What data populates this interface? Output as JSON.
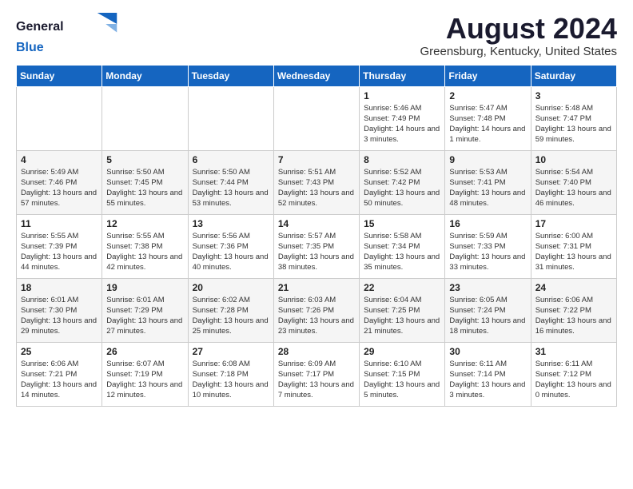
{
  "header": {
    "logo_line1": "General",
    "logo_line2": "Blue",
    "month_year": "August 2024",
    "location": "Greensburg, Kentucky, United States"
  },
  "weekdays": [
    "Sunday",
    "Monday",
    "Tuesday",
    "Wednesday",
    "Thursday",
    "Friday",
    "Saturday"
  ],
  "weeks": [
    [
      {
        "day": "",
        "content": ""
      },
      {
        "day": "",
        "content": ""
      },
      {
        "day": "",
        "content": ""
      },
      {
        "day": "",
        "content": ""
      },
      {
        "day": "1",
        "content": "Sunrise: 5:46 AM\nSunset: 7:49 PM\nDaylight: 14 hours\nand 3 minutes."
      },
      {
        "day": "2",
        "content": "Sunrise: 5:47 AM\nSunset: 7:48 PM\nDaylight: 14 hours\nand 1 minute."
      },
      {
        "day": "3",
        "content": "Sunrise: 5:48 AM\nSunset: 7:47 PM\nDaylight: 13 hours\nand 59 minutes."
      }
    ],
    [
      {
        "day": "4",
        "content": "Sunrise: 5:49 AM\nSunset: 7:46 PM\nDaylight: 13 hours\nand 57 minutes."
      },
      {
        "day": "5",
        "content": "Sunrise: 5:50 AM\nSunset: 7:45 PM\nDaylight: 13 hours\nand 55 minutes."
      },
      {
        "day": "6",
        "content": "Sunrise: 5:50 AM\nSunset: 7:44 PM\nDaylight: 13 hours\nand 53 minutes."
      },
      {
        "day": "7",
        "content": "Sunrise: 5:51 AM\nSunset: 7:43 PM\nDaylight: 13 hours\nand 52 minutes."
      },
      {
        "day": "8",
        "content": "Sunrise: 5:52 AM\nSunset: 7:42 PM\nDaylight: 13 hours\nand 50 minutes."
      },
      {
        "day": "9",
        "content": "Sunrise: 5:53 AM\nSunset: 7:41 PM\nDaylight: 13 hours\nand 48 minutes."
      },
      {
        "day": "10",
        "content": "Sunrise: 5:54 AM\nSunset: 7:40 PM\nDaylight: 13 hours\nand 46 minutes."
      }
    ],
    [
      {
        "day": "11",
        "content": "Sunrise: 5:55 AM\nSunset: 7:39 PM\nDaylight: 13 hours\nand 44 minutes."
      },
      {
        "day": "12",
        "content": "Sunrise: 5:55 AM\nSunset: 7:38 PM\nDaylight: 13 hours\nand 42 minutes."
      },
      {
        "day": "13",
        "content": "Sunrise: 5:56 AM\nSunset: 7:36 PM\nDaylight: 13 hours\nand 40 minutes."
      },
      {
        "day": "14",
        "content": "Sunrise: 5:57 AM\nSunset: 7:35 PM\nDaylight: 13 hours\nand 38 minutes."
      },
      {
        "day": "15",
        "content": "Sunrise: 5:58 AM\nSunset: 7:34 PM\nDaylight: 13 hours\nand 35 minutes."
      },
      {
        "day": "16",
        "content": "Sunrise: 5:59 AM\nSunset: 7:33 PM\nDaylight: 13 hours\nand 33 minutes."
      },
      {
        "day": "17",
        "content": "Sunrise: 6:00 AM\nSunset: 7:31 PM\nDaylight: 13 hours\nand 31 minutes."
      }
    ],
    [
      {
        "day": "18",
        "content": "Sunrise: 6:01 AM\nSunset: 7:30 PM\nDaylight: 13 hours\nand 29 minutes."
      },
      {
        "day": "19",
        "content": "Sunrise: 6:01 AM\nSunset: 7:29 PM\nDaylight: 13 hours\nand 27 minutes."
      },
      {
        "day": "20",
        "content": "Sunrise: 6:02 AM\nSunset: 7:28 PM\nDaylight: 13 hours\nand 25 minutes."
      },
      {
        "day": "21",
        "content": "Sunrise: 6:03 AM\nSunset: 7:26 PM\nDaylight: 13 hours\nand 23 minutes."
      },
      {
        "day": "22",
        "content": "Sunrise: 6:04 AM\nSunset: 7:25 PM\nDaylight: 13 hours\nand 21 minutes."
      },
      {
        "day": "23",
        "content": "Sunrise: 6:05 AM\nSunset: 7:24 PM\nDaylight: 13 hours\nand 18 minutes."
      },
      {
        "day": "24",
        "content": "Sunrise: 6:06 AM\nSunset: 7:22 PM\nDaylight: 13 hours\nand 16 minutes."
      }
    ],
    [
      {
        "day": "25",
        "content": "Sunrise: 6:06 AM\nSunset: 7:21 PM\nDaylight: 13 hours\nand 14 minutes."
      },
      {
        "day": "26",
        "content": "Sunrise: 6:07 AM\nSunset: 7:19 PM\nDaylight: 13 hours\nand 12 minutes."
      },
      {
        "day": "27",
        "content": "Sunrise: 6:08 AM\nSunset: 7:18 PM\nDaylight: 13 hours\nand 10 minutes."
      },
      {
        "day": "28",
        "content": "Sunrise: 6:09 AM\nSunset: 7:17 PM\nDaylight: 13 hours\nand 7 minutes."
      },
      {
        "day": "29",
        "content": "Sunrise: 6:10 AM\nSunset: 7:15 PM\nDaylight: 13 hours\nand 5 minutes."
      },
      {
        "day": "30",
        "content": "Sunrise: 6:11 AM\nSunset: 7:14 PM\nDaylight: 13 hours\nand 3 minutes."
      },
      {
        "day": "31",
        "content": "Sunrise: 6:11 AM\nSunset: 7:12 PM\nDaylight: 13 hours\nand 0 minutes."
      }
    ]
  ]
}
